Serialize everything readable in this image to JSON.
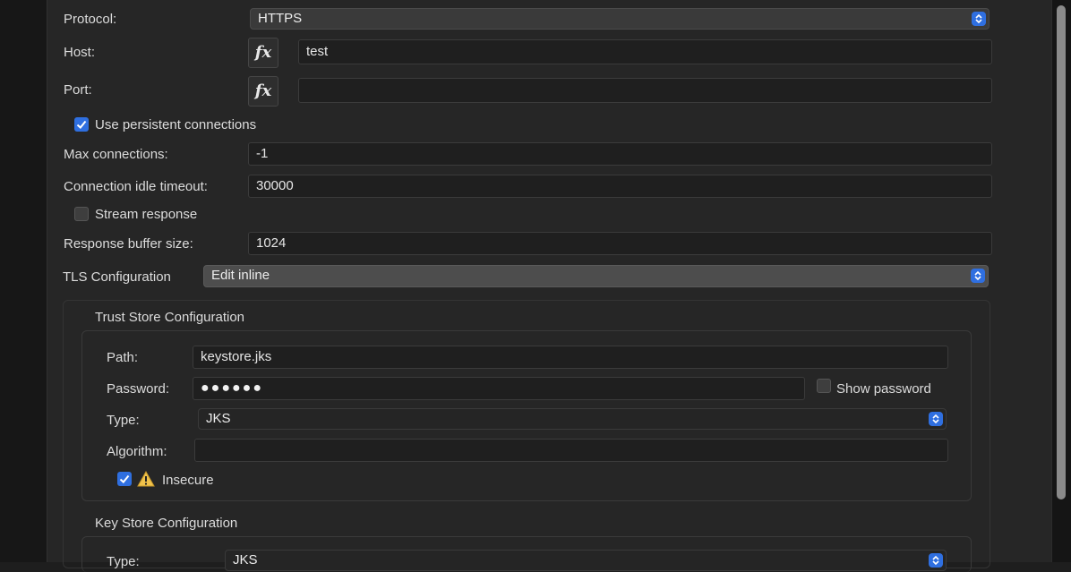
{
  "form": {
    "protocol": {
      "label": "Protocol:",
      "value": "HTTPS"
    },
    "host": {
      "label": "Host:",
      "fx": "fx",
      "value": "test"
    },
    "port": {
      "label": "Port:",
      "fx": "fx",
      "value": ""
    },
    "persistent": {
      "label": "Use persistent connections",
      "checked": true
    },
    "max_connections": {
      "label": "Max connections:",
      "value": "-1"
    },
    "idle_timeout": {
      "label": "Connection idle timeout:",
      "value": "30000"
    },
    "stream_response": {
      "label": "Stream response",
      "checked": false
    },
    "buffer_size": {
      "label": "Response buffer size:",
      "value": "1024"
    },
    "tls": {
      "label": "TLS Configuration",
      "value": "Edit inline"
    }
  },
  "trust_store": {
    "title": "Trust Store Configuration",
    "path": {
      "label": "Path:",
      "value": "keystore.jks"
    },
    "password": {
      "label": "Password:",
      "masked": "●●●●●●"
    },
    "show_password": {
      "label": "Show password",
      "checked": false
    },
    "type": {
      "label": "Type:",
      "value": "JKS"
    },
    "algorithm": {
      "label": "Algorithm:",
      "value": ""
    },
    "insecure": {
      "label": "Insecure",
      "checked": true,
      "icon": "warning-icon"
    }
  },
  "key_store": {
    "title": "Key Store Configuration",
    "type": {
      "label": "Type:",
      "value": "JKS"
    }
  },
  "colors": {
    "accent": "#2f6fe0",
    "background": "#262626"
  }
}
